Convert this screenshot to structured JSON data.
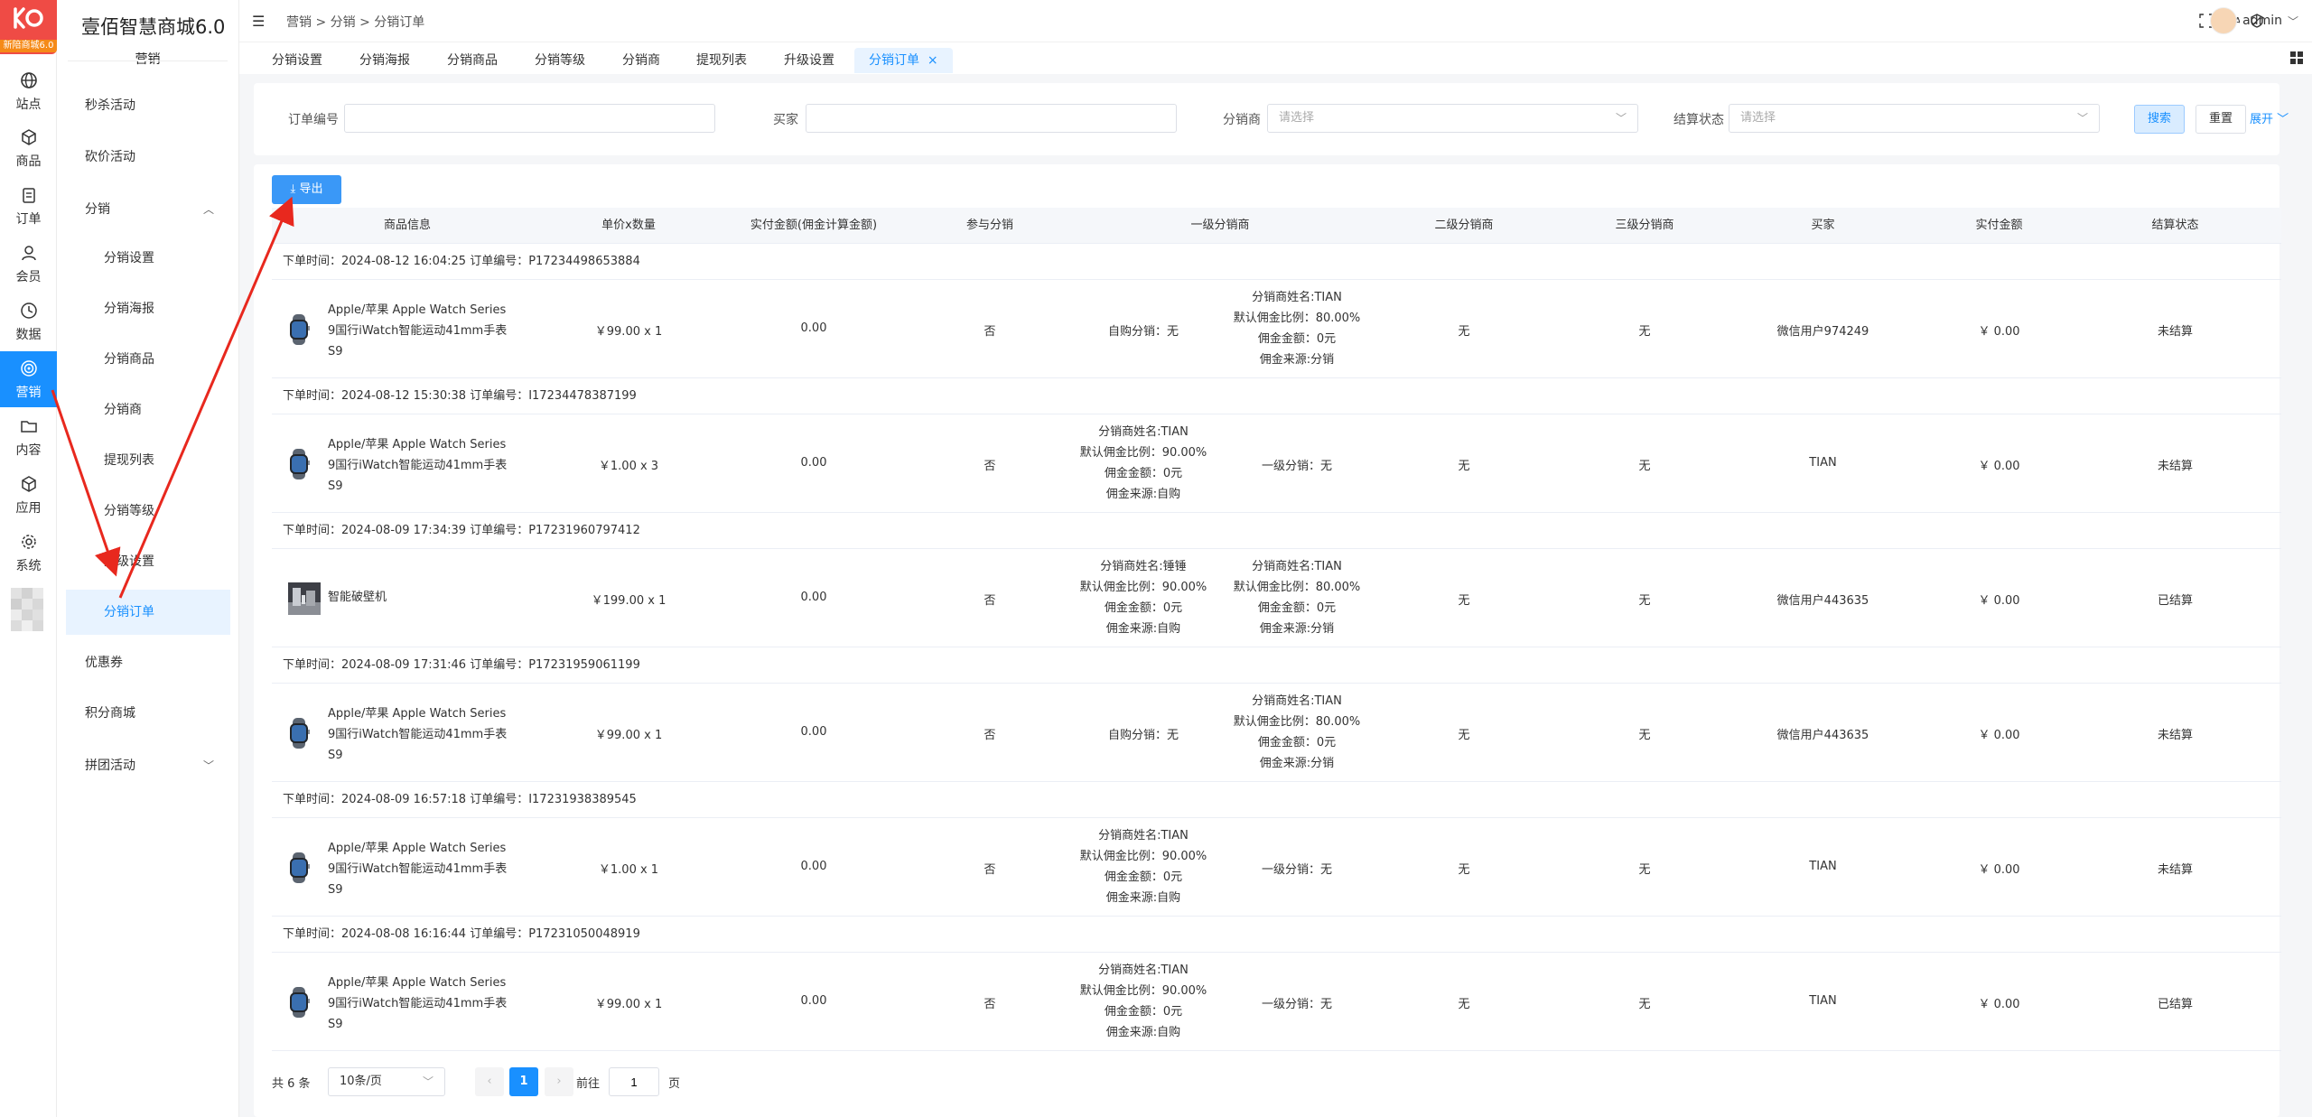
{
  "brand": {
    "logo_badge": "新陪商城6.0",
    "title": "壹佰智慧商城6.0"
  },
  "rail": {
    "items": [
      {
        "label": "站点",
        "icon": "globe-icon"
      },
      {
        "label": "商品",
        "icon": "box-icon"
      },
      {
        "label": "订单",
        "icon": "clipboard-icon"
      },
      {
        "label": "会员",
        "icon": "user-icon"
      },
      {
        "label": "数据",
        "icon": "clock-icon"
      },
      {
        "label": "营销",
        "icon": "target-icon",
        "active": true
      },
      {
        "label": "内容",
        "icon": "folder-icon"
      },
      {
        "label": "应用",
        "icon": "cube-icon"
      },
      {
        "label": "系统",
        "icon": "gear-icon"
      }
    ]
  },
  "sub": {
    "group": "营销",
    "items": [
      {
        "label": "秒杀活动"
      },
      {
        "label": "砍价活动"
      },
      {
        "label": "分销",
        "expanded": true
      },
      {
        "label": "分销设置"
      },
      {
        "label": "分销海报"
      },
      {
        "label": "分销商品"
      },
      {
        "label": "分销商"
      },
      {
        "label": "提现列表"
      },
      {
        "label": "分销等级"
      },
      {
        "label": "升级设置"
      },
      {
        "label": "分销订单"
      },
      {
        "label": "优惠券"
      },
      {
        "label": "积分商城"
      },
      {
        "label": "拼团活动"
      }
    ]
  },
  "header": {
    "crumbs": "营销  >  分销  >  分销订单",
    "user": "admin"
  },
  "tabs": [
    {
      "label": "分销设置"
    },
    {
      "label": "分销海报"
    },
    {
      "label": "分销商品"
    },
    {
      "label": "分销等级"
    },
    {
      "label": "分销商"
    },
    {
      "label": "提现列表"
    },
    {
      "label": "升级设置"
    },
    {
      "label": "分销订单",
      "active": true,
      "close": "×"
    }
  ],
  "filters": {
    "order_no": {
      "label": "订单编号",
      "value": ""
    },
    "buyer": {
      "label": "买家",
      "value": ""
    },
    "distributor": {
      "label": "分销商",
      "placeholder": "请选择"
    },
    "settle": {
      "label": "结算状态",
      "placeholder": "请选择"
    },
    "search": "搜索",
    "reset": "重置",
    "expand": "展开"
  },
  "export_label": "导出",
  "columns": [
    "商品信息",
    "单价x数量",
    "实付金额(佣金计算金额)",
    "参与分销",
    "一级分销商",
    "二级分销商",
    "三级分销商",
    "买家",
    "实付金额",
    "结算状态"
  ],
  "orders": [
    {
      "header": "下单时间：2024-08-12 16:04:25   订单编号：P17234498653884",
      "product": "Apple/苹果 Apple Watch Series 9国行iWatch智能运动41mm手表S9",
      "thumb": "watch",
      "price_qty": "￥99.00 x 1",
      "calc_amount": "0.00",
      "joined": "否",
      "self_buy": "自购分销：无",
      "level1": [
        "分销商姓名:TIAN",
        "默认佣金比例：80.00%",
        "佣金金额：0元",
        "佣金来源:分销"
      ],
      "level2": "无",
      "level3": "无",
      "buyer": "微信用户974249",
      "paid": "￥ 0.00",
      "status": "未结算"
    },
    {
      "header": "下单时间：2024-08-12 15:30:38   订单编号：I17234478387199",
      "product": "Apple/苹果 Apple Watch Series 9国行iWatch智能运动41mm手表S9",
      "thumb": "watch",
      "price_qty": "￥1.00 x 3",
      "calc_amount": "0.00",
      "joined": "否",
      "self_buy_block": [
        "分销商姓名:TIAN",
        "默认佣金比例：90.00%",
        "佣金金额：0元",
        "佣金来源:自购"
      ],
      "level1_text": "一级分销：无",
      "level2": "无",
      "level3": "无",
      "buyer": "TIAN",
      "paid": "￥ 0.00",
      "status": "未结算"
    },
    {
      "header": "下单时间：2024-08-09 17:34:39   订单编号：P17231960797412",
      "product": "智能破壁机",
      "thumb": "blender",
      "price_qty": "￥199.00 x 1",
      "calc_amount": "0.00",
      "joined": "否",
      "self_buy_block": [
        "分销商姓名:锤锤",
        "默认佣金比例：90.00%",
        "佣金金额：0元",
        "佣金来源:自购"
      ],
      "level1": [
        "分销商姓名:TIAN",
        "默认佣金比例：80.00%",
        "佣金金额：0元",
        "佣金来源:分销"
      ],
      "level2": "无",
      "level3": "无",
      "buyer": "微信用户443635",
      "paid": "￥ 0.00",
      "status": "已结算"
    },
    {
      "header": "下单时间：2024-08-09 17:31:46   订单编号：P17231959061199",
      "product": "Apple/苹果 Apple Watch Series 9国行iWatch智能运动41mm手表S9",
      "thumb": "watch",
      "price_qty": "￥99.00 x 1",
      "calc_amount": "0.00",
      "joined": "否",
      "self_buy": "自购分销：无",
      "level1": [
        "分销商姓名:TIAN",
        "默认佣金比例：80.00%",
        "佣金金额：0元",
        "佣金来源:分销"
      ],
      "level2": "无",
      "level3": "无",
      "buyer": "微信用户443635",
      "paid": "￥ 0.00",
      "status": "未结算"
    },
    {
      "header": "下单时间：2024-08-09 16:57:18   订单编号：I17231938389545",
      "product": "Apple/苹果 Apple Watch Series 9国行iWatch智能运动41mm手表S9",
      "thumb": "watch",
      "price_qty": "￥1.00 x 1",
      "calc_amount": "0.00",
      "joined": "否",
      "self_buy_block": [
        "分销商姓名:TIAN",
        "默认佣金比例：90.00%",
        "佣金金额：0元",
        "佣金来源:自购"
      ],
      "level1_text": "一级分销：无",
      "level2": "无",
      "level3": "无",
      "buyer": "TIAN",
      "paid": "￥ 0.00",
      "status": "未结算"
    },
    {
      "header": "下单时间：2024-08-08 16:16:44   订单编号：P17231050048919",
      "product": "Apple/苹果 Apple Watch Series 9国行iWatch智能运动41mm手表S9",
      "thumb": "watch",
      "price_qty": "￥99.00 x 1",
      "calc_amount": "0.00",
      "joined": "否",
      "self_buy_block": [
        "分销商姓名:TIAN",
        "默认佣金比例：90.00%",
        "佣金金额：0元",
        "佣金来源:自购"
      ],
      "level1_text": "一级分销：无",
      "level2": "无",
      "level3": "无",
      "buyer": "TIAN",
      "paid": "￥ 0.00",
      "status": "已结算"
    }
  ],
  "pager": {
    "total": "共 6 条",
    "size": "10条/页",
    "prev": "‹",
    "next": "›",
    "current": "1",
    "goto": "前往",
    "goto_value": "1",
    "page_suffix": "页"
  },
  "colors": {
    "accent": "#1990ff",
    "brand": "#ef4b45",
    "annotation": "#e8281e"
  }
}
